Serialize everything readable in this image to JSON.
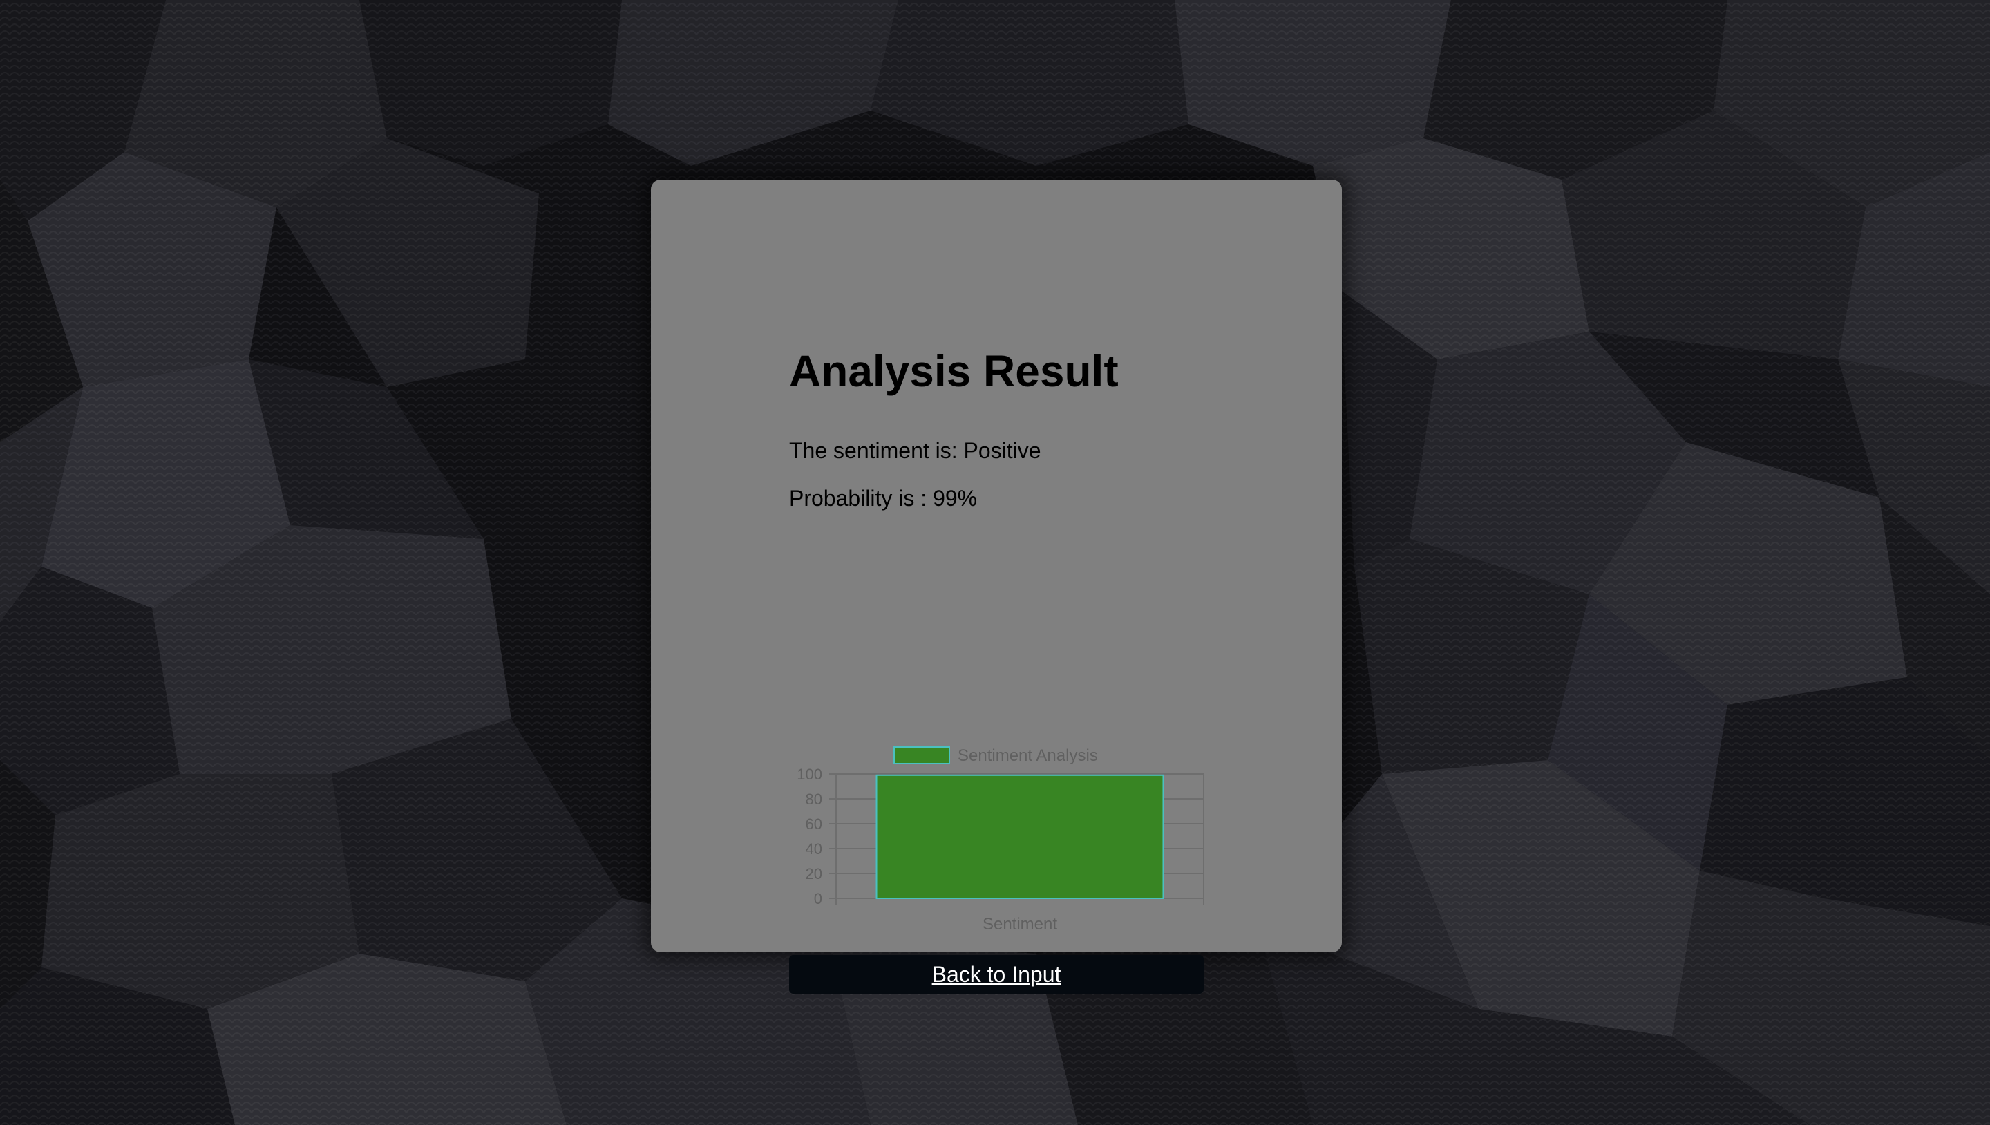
{
  "result": {
    "title": "Analysis Result",
    "sentiment_text": "The sentiment is: Positive",
    "probability_text": "Probability is : 99%"
  },
  "actions": {
    "back_label": "Back to Input"
  },
  "colors": {
    "card_background": "#808080",
    "bar_fill": "#388523",
    "bar_border": "#4bc0c0",
    "button_background": "#050a10",
    "button_text": "#ffffff"
  },
  "chart_data": {
    "type": "bar",
    "categories": [
      "Sentiment"
    ],
    "series": [
      {
        "name": "Sentiment Analysis",
        "values": [
          99
        ]
      }
    ],
    "ylim": [
      0,
      100
    ],
    "yticks": [
      0,
      20,
      40,
      60,
      80,
      100
    ],
    "legend_position": "top",
    "grid": true
  }
}
